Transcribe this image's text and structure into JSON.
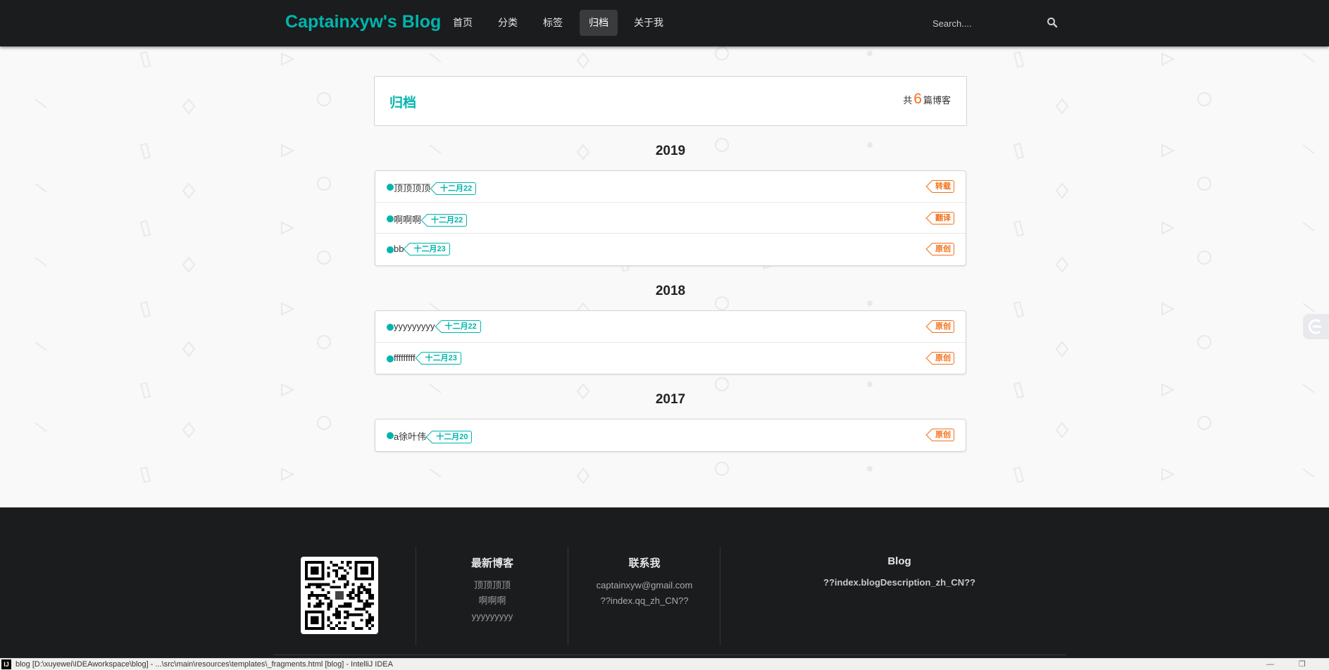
{
  "nav": {
    "brand": "Captainxyw's Blog",
    "items": [
      {
        "label": "首页",
        "active": false
      },
      {
        "label": "分类",
        "active": false
      },
      {
        "label": "标签",
        "active": false
      },
      {
        "label": "归档",
        "active": true
      },
      {
        "label": "关于我",
        "active": false
      }
    ],
    "search_placeholder": "Search....",
    "search_icon": "search-icon"
  },
  "archive": {
    "title": "归档",
    "count_prefix": "共",
    "count": "6",
    "count_suffix": "篇博客",
    "years": [
      {
        "year": "2019",
        "posts": [
          {
            "title": "顶顶顶顶",
            "date": "十二月22",
            "type": "转载"
          },
          {
            "title": "啊啊啊",
            "date": "十二月22",
            "type": "翻译"
          },
          {
            "title": "bb",
            "date": "十二月23",
            "type": "原创"
          }
        ]
      },
      {
        "year": "2018",
        "posts": [
          {
            "title": "yyyyyyyyy",
            "date": "十二月22",
            "type": "原创"
          },
          {
            "title": "fffffffff",
            "date": "十二月23",
            "type": "原创"
          }
        ]
      },
      {
        "year": "2017",
        "posts": [
          {
            "title": "a徐叶伟",
            "date": "十二月20",
            "type": "原创"
          }
        ]
      }
    ]
  },
  "footer": {
    "latest_title": "最新博客",
    "latest": [
      "顶顶顶顶",
      "啊啊啊",
      "yyyyyyyyy"
    ],
    "contact_title": "联系我",
    "contact": [
      "captainxyw@gmail.com",
      "??index.qq_zh_CN??"
    ],
    "blog_title": "Blog",
    "blog_desc": "??index.blogDescription_zh_CN??"
  },
  "taskbar": {
    "title": "blog [D:\\xuyewei\\IDEAworkspace\\blog] - ...\\src\\main\\resources\\templates\\_fragments.html [blog] - IntelliJ IDEA"
  },
  "colors": {
    "accent": "#00b5ad",
    "orange": "#f2711c",
    "navbar": "#1b1c1d"
  }
}
